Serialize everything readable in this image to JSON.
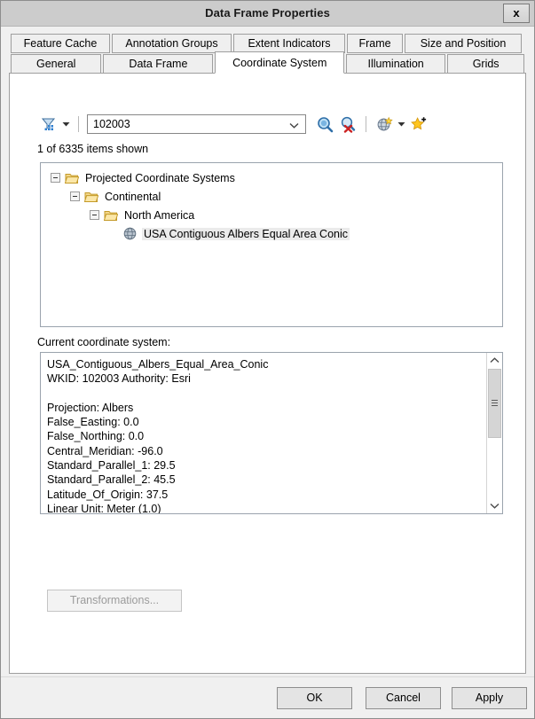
{
  "window": {
    "title": "Data Frame Properties",
    "close_label": "x"
  },
  "tabs": {
    "row1": [
      {
        "label": "Feature Cache",
        "active": false
      },
      {
        "label": "Annotation Groups",
        "active": false
      },
      {
        "label": "Extent Indicators",
        "active": false
      },
      {
        "label": "Frame",
        "active": false
      },
      {
        "label": "Size and Position",
        "active": false
      }
    ],
    "row2": [
      {
        "label": "General",
        "active": false
      },
      {
        "label": "Data Frame",
        "active": false
      },
      {
        "label": "Coordinate System",
        "active": true
      },
      {
        "label": "Illumination",
        "active": false
      },
      {
        "label": "Grids",
        "active": false
      }
    ]
  },
  "toolbar": {
    "filter_icon": "filter-funnel-icon",
    "filter_dropdown_icon": "chevron-down-icon",
    "search_value": "102003",
    "search_placeholder": "",
    "combo_caret_icon": "chevron-down-icon",
    "search_icon": "magnifier-search-icon",
    "clear_search_icon": "magnifier-clear-search-icon",
    "globe_icon": "globe-add-icon",
    "globe_dropdown_icon": "chevron-down-icon",
    "favorites_icon": "star-add-favorite-icon"
  },
  "status": {
    "items_shown": "1 of 6335 items shown"
  },
  "tree": {
    "nodes": [
      {
        "label": "Projected Coordinate Systems",
        "indent": 0,
        "icon": "folder-open-icon",
        "expander": "minus-box-icon",
        "selected": false
      },
      {
        "label": "Continental",
        "indent": 1,
        "icon": "folder-open-icon",
        "expander": "minus-box-icon",
        "selected": false
      },
      {
        "label": "North America",
        "indent": 2,
        "icon": "folder-open-icon",
        "expander": "minus-box-icon",
        "selected": false
      },
      {
        "label": "USA Contiguous Albers Equal Area Conic",
        "indent": 3,
        "icon": "globe-coordinate-system-icon",
        "expander": null,
        "selected": true
      }
    ]
  },
  "current_cs": {
    "label": "Current coordinate system:",
    "text": "USA_Contiguous_Albers_Equal_Area_Conic\nWKID: 102003 Authority: Esri\n\nProjection: Albers\nFalse_Easting: 0.0\nFalse_Northing: 0.0\nCentral_Meridian: -96.0\nStandard_Parallel_1: 29.5\nStandard_Parallel_2: 45.5\nLatitude_Of_Origin: 37.5\nLinear Unit: Meter (1.0)",
    "scroll_up_icon": "chevron-up-icon",
    "scroll_down_icon": "chevron-down-icon"
  },
  "actions": {
    "transformations_label": "Transformations...",
    "ok_label": "OK",
    "cancel_label": "Cancel",
    "apply_label": "Apply"
  },
  "colors": {
    "titlebar": "#cccccc",
    "dialog": "#f0f0f0",
    "panel": "#ffffff",
    "selection": "#ebebeb",
    "folder": "#e8c35c",
    "accent_blue": "#3b7fc4"
  }
}
